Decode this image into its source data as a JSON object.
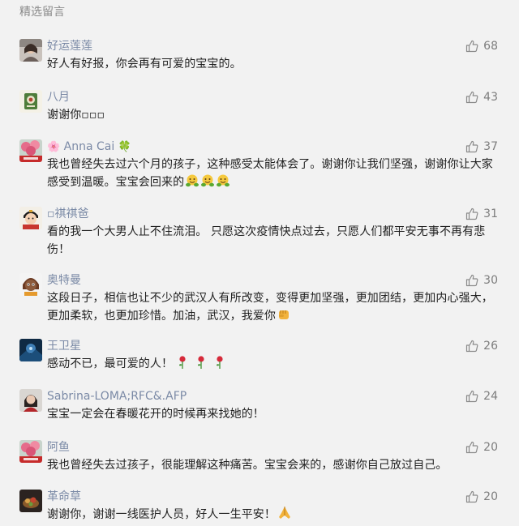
{
  "section_title": "精选留言",
  "colors": {
    "background": "#f2f2f2",
    "nickname": "#7b8aa6",
    "body_text": "#1f1f1f",
    "like_count": "#7d7d7d",
    "section_title": "#8a8a8a"
  },
  "comments": [
    {
      "nickname": "好运莲莲",
      "likes": "68",
      "text": "好人有好报，你会再有可爱的宝宝的。",
      "avatar_icon": "woman-portrait-avatar"
    },
    {
      "nickname": "八月",
      "likes": "43",
      "text": "谢谢你▫▫▫",
      "avatar_icon": "green-logo-avatar"
    },
    {
      "nickname_prefix": "🌸",
      "nickname": "Anna Cai",
      "nickname_suffix": "🍀",
      "likes": "37",
      "text": "我也曾经失去过六个月的孩子，这种感受太能体会了。谢谢你让我们坚强，谢谢你让大家感受到温暖。宝宝会回来的",
      "emoji_icons": [
        "hugging-face-emoji",
        "hugging-face-emoji",
        "hugging-face-emoji"
      ],
      "avatar_icon": "wuhan-flowers-avatar"
    },
    {
      "nickname": "▫祺祺爸",
      "likes": "31",
      "text": "看的我一个大男人止不住流泪。 只愿这次疫情快点过去，只愿人们都平安无事不再有悲伤！",
      "avatar_icon": "cartoon-child-avatar"
    },
    {
      "nickname": "奥特曼",
      "likes": "30",
      "text": "这段日子，相信也让不少的武汉人有所改变，变得更加坚强，更加团结，更加内心强大，更加柔软，也更加珍惜。加油，武汉，我爱你",
      "emoji_icons": [
        "fist-emoji"
      ],
      "avatar_icon": "cartoon-girl-avatar"
    },
    {
      "nickname": "王卫星",
      "likes": "26",
      "text": "感动不已，最可爱的人！",
      "emoji_icons": [
        "rose-emoji",
        "rose-emoji",
        "rose-emoji"
      ],
      "avatar_icon": "dark-blue-landscape-avatar"
    },
    {
      "nickname": "Sabrina-LOMA;RFC&.AFP",
      "likes": "24",
      "text": "宝宝一定会在春暖花开的时候再来找她的！",
      "avatar_icon": "woman-red-scarf-avatar"
    },
    {
      "nickname": "阿鱼",
      "likes": "20",
      "text": "我也曾经失去过孩子，很能理解这种痛苦。宝宝会来的，感谢你自己放过自己。",
      "avatar_icon": "wuhan-flowers-avatar"
    },
    {
      "nickname": "革命草",
      "likes": "20",
      "text": "谢谢你，谢谢一线医护人员，好人一生平安！",
      "emoji_icons": [
        "praying-hands-emoji"
      ],
      "avatar_icon": "dark-food-avatar"
    }
  ]
}
